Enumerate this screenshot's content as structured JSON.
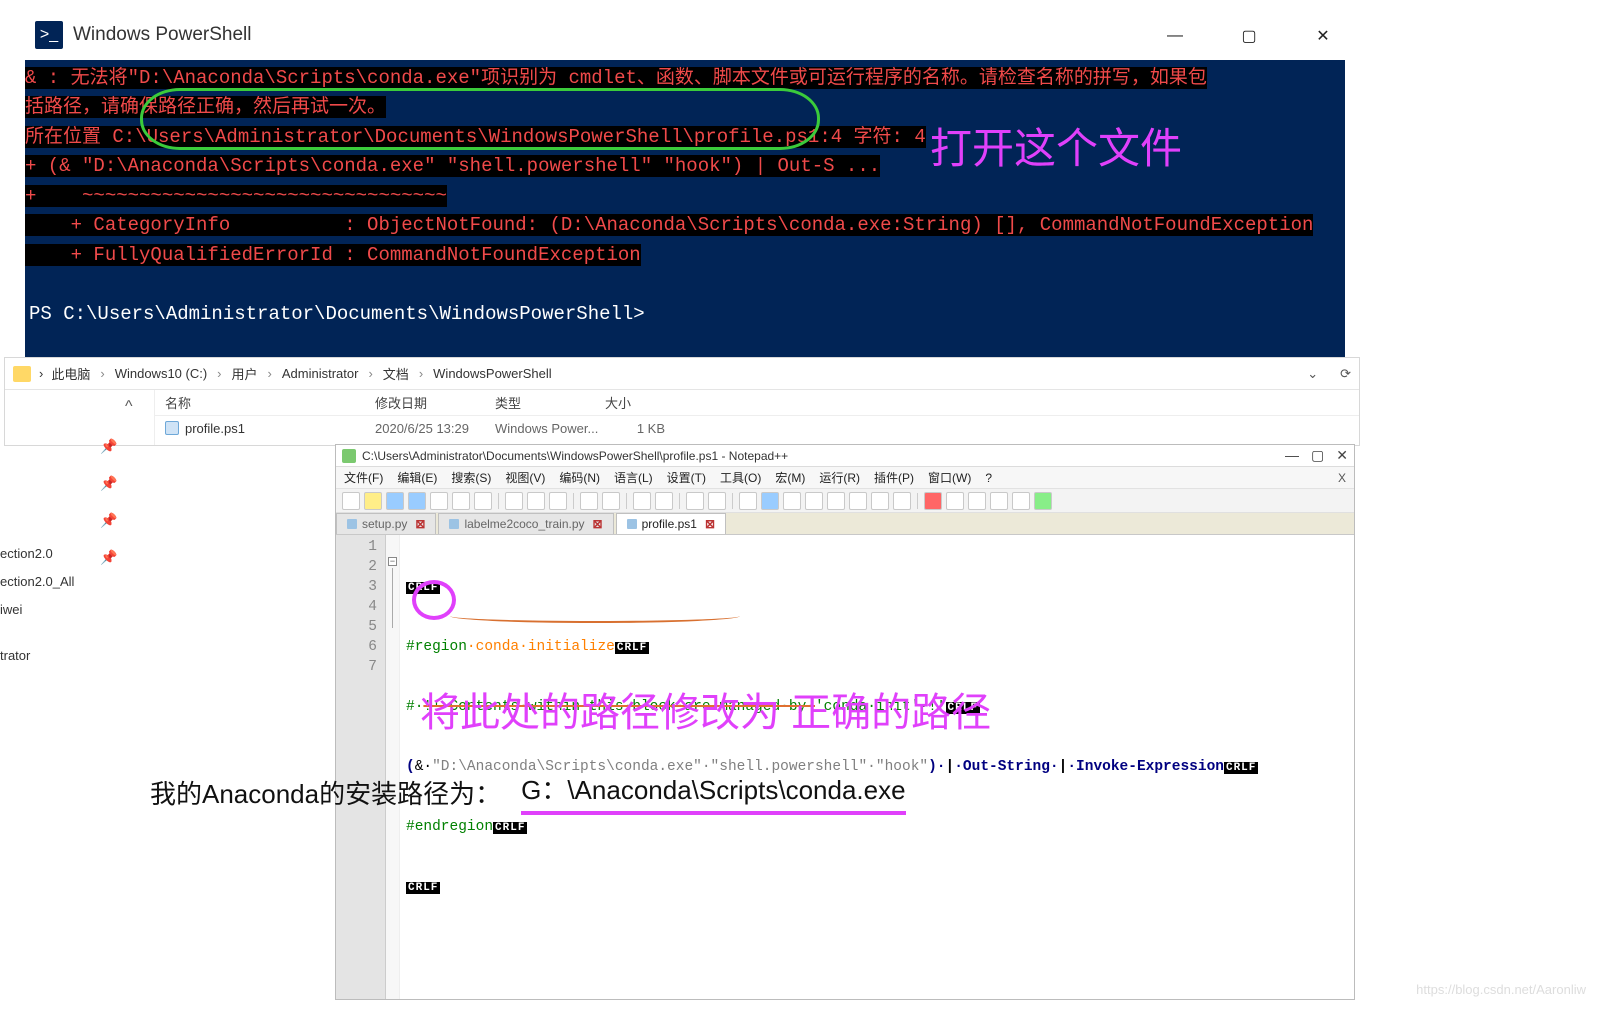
{
  "powershell": {
    "title": "Windows PowerShell",
    "error_l1_a": "& : 无法将\"D:\\Anaconda\\Scripts\\conda.exe\"项识别为 cmdlet、函数、脚本文件或可运行程序的名称。请检查名称的拼写，如果包",
    "error_l2": "括路径，请确保路径正确，然后再试一次。",
    "error_l3": "所在位置 C:\\Users\\Administrator\\Documents\\WindowsPowerShell\\profile.ps1:4 字符: 4",
    "error_l4": "+ (& \"D:\\Anaconda\\Scripts\\conda.exe\" \"shell.powershell\" \"hook\") | Out-S ...",
    "error_l5": "+    ~~~~~~~~~~~~~~~~~~~~~~~~~~~~~~~~",
    "error_l6": "    + CategoryInfo          : ObjectNotFound: (D:\\Anaconda\\Scripts\\conda.exe:String) [], CommandNotFoundException",
    "error_l7": "    + FullyQualifiedErrorId : CommandNotFoundException",
    "prompt": "PS C:\\Users\\Administrator\\Documents\\WindowsPowerShell>",
    "annotation": "打开这个文件"
  },
  "explorer": {
    "breadcrumbs": [
      "此电脑",
      "Windows10 (C:)",
      "用户",
      "Administrator",
      "文档",
      "WindowsPowerShell"
    ],
    "headers": {
      "name": "名称",
      "date": "修改日期",
      "type": "类型",
      "size": "大小"
    },
    "file": {
      "name": "profile.ps1",
      "date": "2020/6/25 13:29",
      "type": "Windows Power...",
      "size": "1 KB"
    }
  },
  "pinlabels": {
    "a": "ection2.0",
    "b": "ection2.0_All",
    "c": "iwei",
    "d": "trator"
  },
  "npp": {
    "title": "C:\\Users\\Administrator\\Documents\\WindowsPowerShell\\profile.ps1 - Notepad++",
    "menus": [
      "文件(F)",
      "编辑(E)",
      "搜索(S)",
      "视图(V)",
      "编码(N)",
      "语言(L)",
      "设置(T)",
      "工具(O)",
      "宏(M)",
      "运行(R)",
      "插件(P)",
      "窗口(W)",
      "?"
    ],
    "tabs": {
      "t1": "setup.py",
      "t2": "labelme2coco_train.py",
      "t3": "profile.ps1"
    },
    "code": {
      "l2_region": "#region",
      "l2_rest": "·conda·initialize",
      "l3_a": "#·",
      "l3_b": "!!·Contents·within·this·block·are·managed·by·",
      "l3_c": "'conda·init'",
      "l3_d": "·!!",
      "l4_paren": "(",
      "l4_amp": "&·",
      "l4_path": "\"D:\\Anaconda\\Scripts\\conda.exe\"",
      "l4_args": "·\"shell.powershell\"·\"hook\"",
      "l4_paren2": ")·",
      "l4_pipe1": "|",
      "l4_out": "·Out-String·",
      "l4_pipe2": "|",
      "l4_invoke": "·Invoke-Expression",
      "l5": "#endregion"
    },
    "crlf": "CRLF"
  },
  "annot2": "将此处的路径修改为 正确的路径",
  "bottom": {
    "label": "我的Anaconda的安装路径为：",
    "path": "G：\\Anaconda\\Scripts\\conda.exe"
  },
  "watermark": "https://blog.csdn.net/Aaronliw"
}
